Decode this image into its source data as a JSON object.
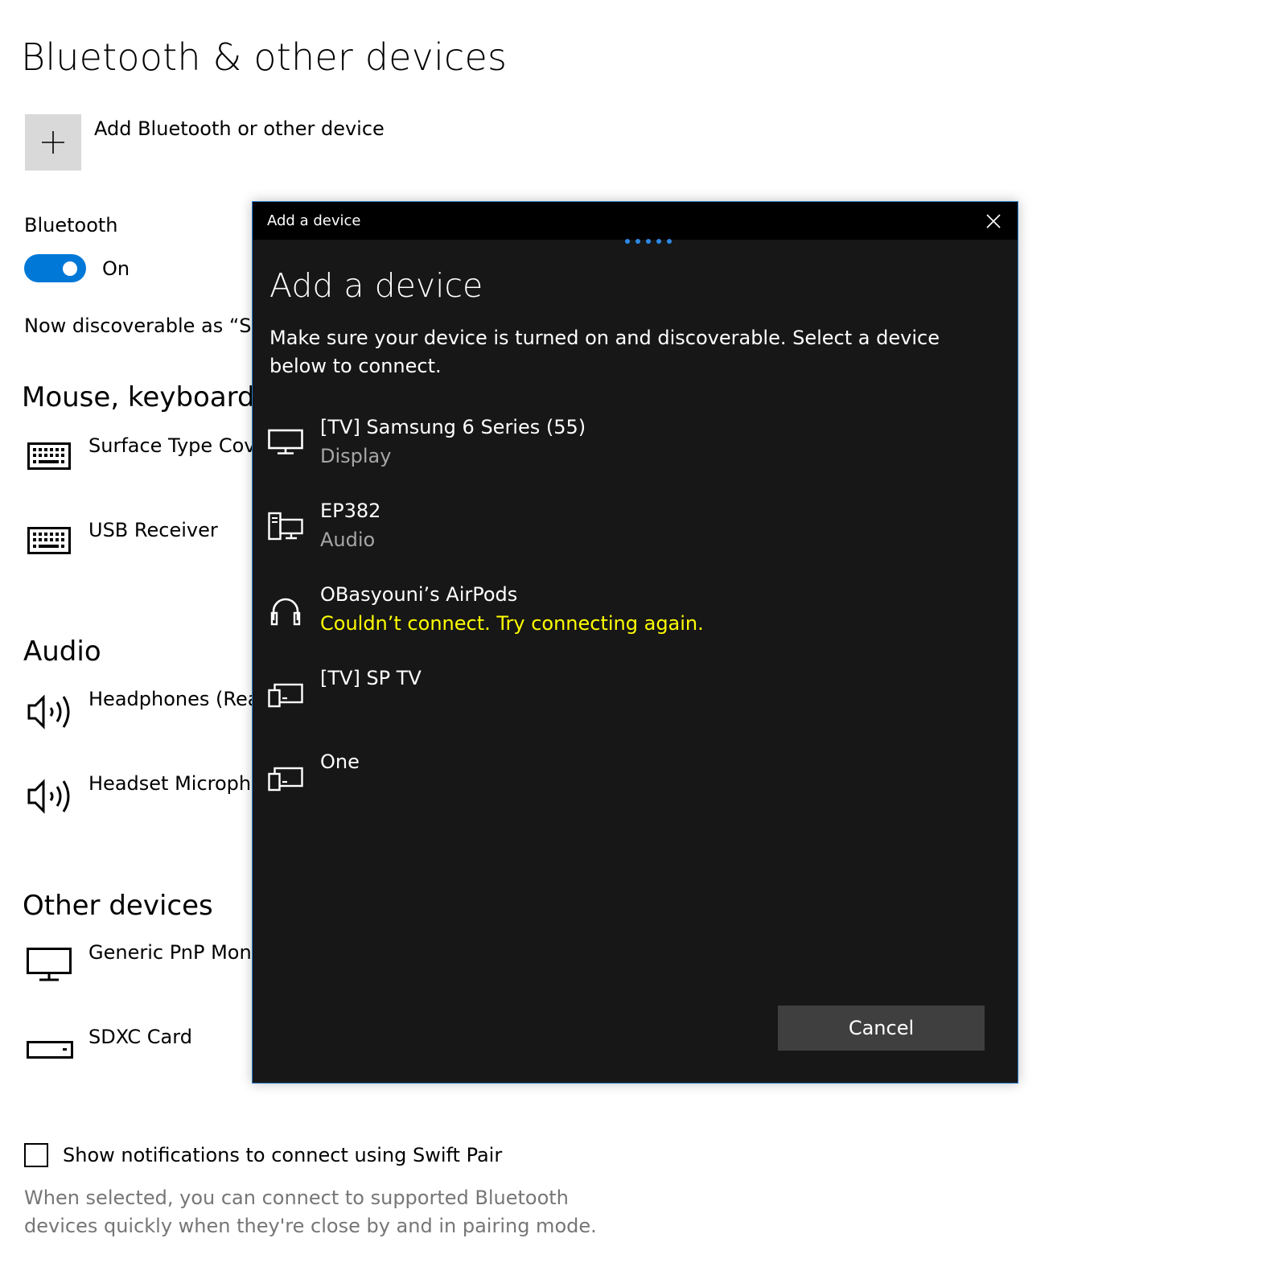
{
  "page": {
    "title": "Bluetooth & other devices",
    "add_device_label": "Add Bluetooth or other device",
    "bluetooth_label": "Bluetooth",
    "bluetooth_state": "On",
    "discoverable_text": "Now discoverable as “SU",
    "sections": {
      "mouse": {
        "title": "Mouse, keyboard, &",
        "devices": [
          {
            "name": "Surface Type Cove",
            "icon": "keyboard-icon"
          },
          {
            "name": "USB Receiver",
            "icon": "keyboard-icon"
          }
        ]
      },
      "audio": {
        "title": "Audio",
        "devices": [
          {
            "name": "Headphones (Rea",
            "icon": "speaker-icon"
          },
          {
            "name": "Headset Micropho",
            "icon": "speaker-icon"
          }
        ]
      },
      "other": {
        "title": "Other devices",
        "devices": [
          {
            "name": "Generic PnP Moni",
            "icon": "monitor-icon"
          },
          {
            "name": "SDXC Card",
            "icon": "drive-icon"
          }
        ]
      }
    },
    "swift_pair_label": "Show notifications to connect using Swift Pair",
    "swift_pair_help": "When selected, you can connect to supported Bluetooth devices quickly when they're close by and in pairing mode.",
    "swift_pair_checked": false
  },
  "dialog": {
    "window_title": "Add a device",
    "heading": "Add a device",
    "description": "Make sure your device is turned on and discoverable. Select a device below to connect.",
    "devices": [
      {
        "name": "[TV] Samsung 6 Series (55)",
        "subtitle": "Display",
        "icon": "display-icon"
      },
      {
        "name": "EP382",
        "subtitle": "Audio",
        "icon": "pc-display-icon"
      },
      {
        "name": "OBasyouni’s AirPods",
        "subtitle": "Couldn’t connect. Try connecting again.",
        "subtitle_error": true,
        "icon": "headphones-icon"
      },
      {
        "name": "[TV] SP TV",
        "subtitle": "",
        "icon": "cast-device-icon"
      },
      {
        "name": "One",
        "subtitle": "",
        "icon": "cast-device-icon"
      }
    ],
    "cancel_label": "Cancel"
  },
  "colors": {
    "accent": "#0078d7",
    "dialog_bg": "#171717",
    "error_text": "#ffff00",
    "button_bg": "#3f3f3f"
  }
}
